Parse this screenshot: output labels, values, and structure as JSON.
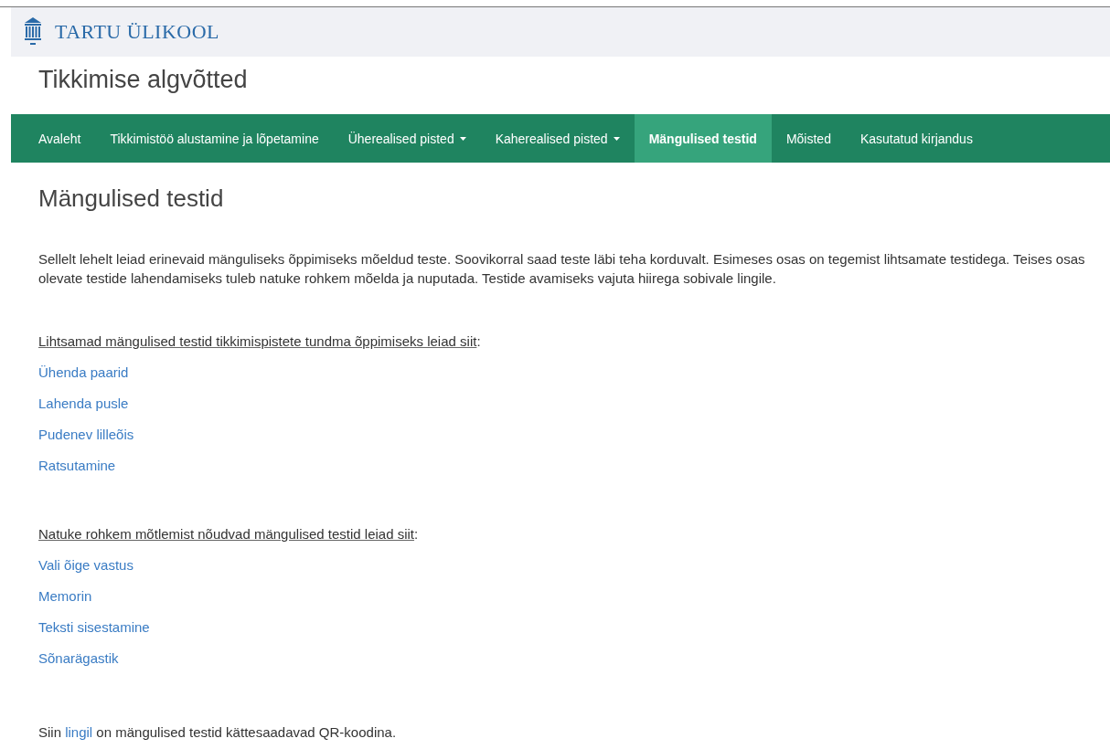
{
  "brand": {
    "name": "TARTU ÜLIKOOL"
  },
  "site_title": "Tikkimise algvõtted",
  "nav": [
    {
      "label": "Avaleht",
      "selected": false,
      "dropdown": false
    },
    {
      "label": "Tikkimistöö alustamine ja lõpetamine",
      "selected": false,
      "dropdown": false
    },
    {
      "label": "Üherealised pisted",
      "selected": false,
      "dropdown": true
    },
    {
      "label": "Kaherealised pisted",
      "selected": false,
      "dropdown": true
    },
    {
      "label": "Mängulised testid",
      "selected": true,
      "dropdown": false
    },
    {
      "label": "Mõisted",
      "selected": false,
      "dropdown": false
    },
    {
      "label": "Kasutatud kirjandus",
      "selected": false,
      "dropdown": false
    }
  ],
  "page_heading": "Mängulised testid",
  "intro": "Sellelt lehelt leiad erinevaid mänguliseks õppimiseks mõeldud teste. Soovikorral saad teste läbi teha korduvalt. Esimeses osas on tegemist lihtsamate testidega. Teises osas olevate testide lahendamiseks tuleb natuke rohkem mõelda ja nuputada. Testide avamiseks vajuta hiirega sobivale lingile.",
  "sections": [
    {
      "heading": "Lihtsamad mängulised testid tikkimispistete tundma õppimiseks leiad siit",
      "punctuation": ":",
      "links": [
        "Ühenda paarid",
        "Lahenda pusle",
        "Pudenev lilleõis",
        "Ratsutamine"
      ]
    },
    {
      "heading": "Natuke rohkem mõtlemist nõudvad mängulised testid leiad siit",
      "punctuation": ":",
      "links": [
        "Vali õige vastus",
        "Memorin",
        "Teksti sisestamine",
        "Sõnarägastik"
      ]
    }
  ],
  "footer_note": {
    "before": "Siin",
    "link": "lingil",
    "after": "on mängulised testid kättesaadavad QR-koodina."
  }
}
